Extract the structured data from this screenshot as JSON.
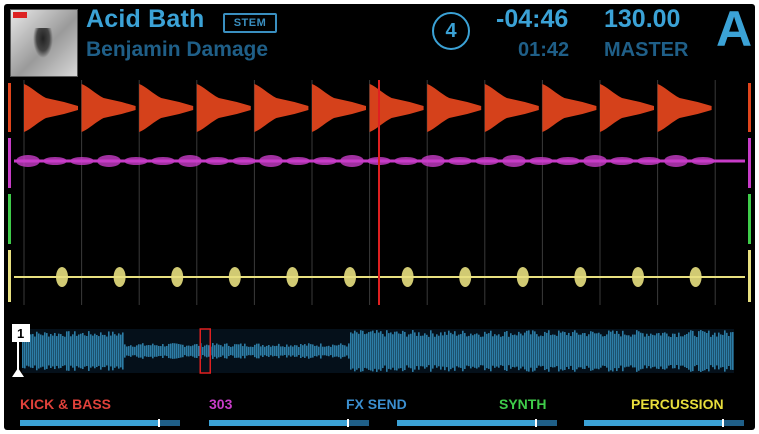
{
  "header": {
    "title": "Acid Bath",
    "stem_badge": "STEM",
    "artist": "Benjamin Damage",
    "deck_number": "4",
    "remaining_time": "-04:46",
    "elapsed_time": "01:42",
    "bpm": "130.00",
    "sync_mode": "MASTER",
    "deck_letter": "A"
  },
  "overview": {
    "cue_marker": "1",
    "playhead_position": 0.27
  },
  "stems": [
    {
      "label": "KICK & BASS",
      "color": "#e0413a",
      "level": 0.86
    },
    {
      "label": "303",
      "color": "#c83cc8",
      "level": 0.86
    },
    {
      "label": "FX SEND",
      "color": "#3b8fd0",
      "level": 0.86
    },
    {
      "label": "SYNTH",
      "color": "#3fcc4a",
      "level": 0.86
    },
    {
      "label": "PERCUSSION",
      "color": "#e8de3c",
      "level": 0.86
    }
  ],
  "colors": {
    "accent": "#3ba2d6",
    "accent_dim": "#1f5f88",
    "kick_bass": "#e0451c",
    "synth_303": "#c83cc8",
    "fx_send": "#3fcc4a",
    "percussion": "#e8e080",
    "playhead": "#e02020"
  }
}
